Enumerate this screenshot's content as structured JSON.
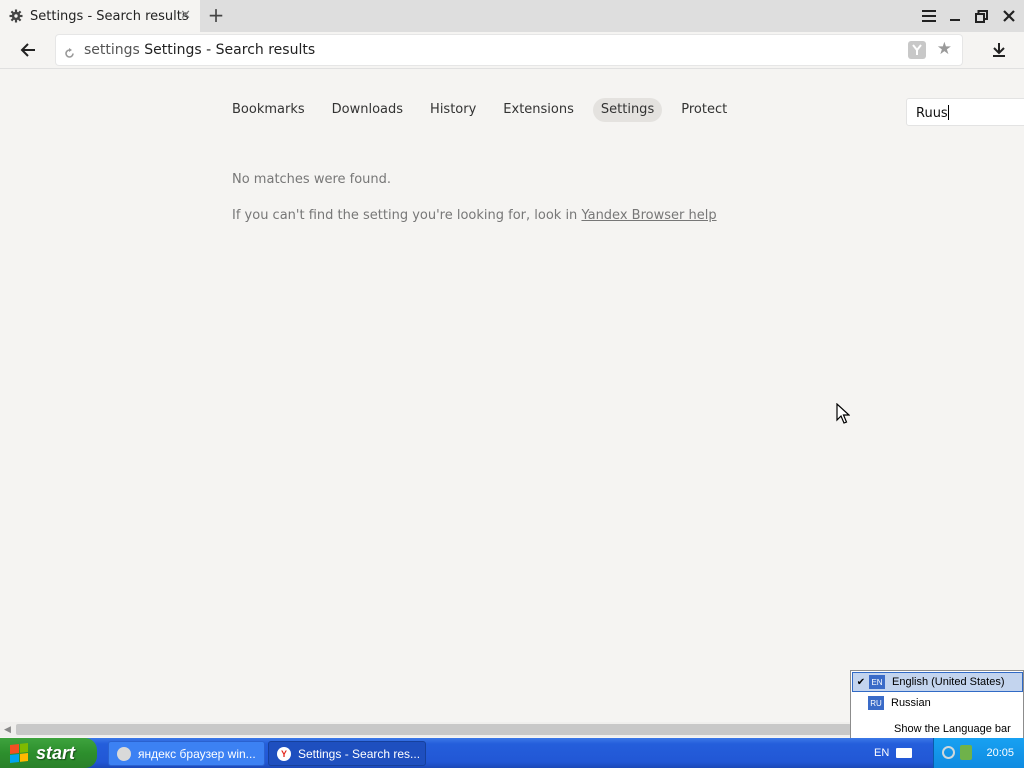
{
  "browser": {
    "tab_title": "Settings - Search results",
    "url_scheme": "settings",
    "url_title": "Settings - Search results"
  },
  "settings_nav": {
    "items": [
      "Bookmarks",
      "Downloads",
      "History",
      "Extensions",
      "Settings",
      "Protect"
    ],
    "active": "Settings"
  },
  "search": {
    "value": "Ruus"
  },
  "results": {
    "no_match": "No matches were found.",
    "help_prefix": "If you can't find the setting you're looking for, look in",
    "help_link": "Yandex Browser help"
  },
  "language_menu": {
    "items": [
      {
        "code": "EN",
        "label": "English (United States)",
        "checked": true
      },
      {
        "code": "RU",
        "label": "Russian",
        "checked": false
      }
    ],
    "show_bar": "Show the Language bar"
  },
  "taskbar": {
    "start_label": "start",
    "tasks": [
      "яндекс браузер win...",
      "Settings - Search res..."
    ],
    "lang_indicator": "EN",
    "clock": "20:05"
  },
  "colors": {
    "page_bg": "#f5f4f2",
    "taskbar_blue": "#245edb",
    "start_green": "#2d8f2d",
    "tray_blue": "#0f8be1"
  }
}
